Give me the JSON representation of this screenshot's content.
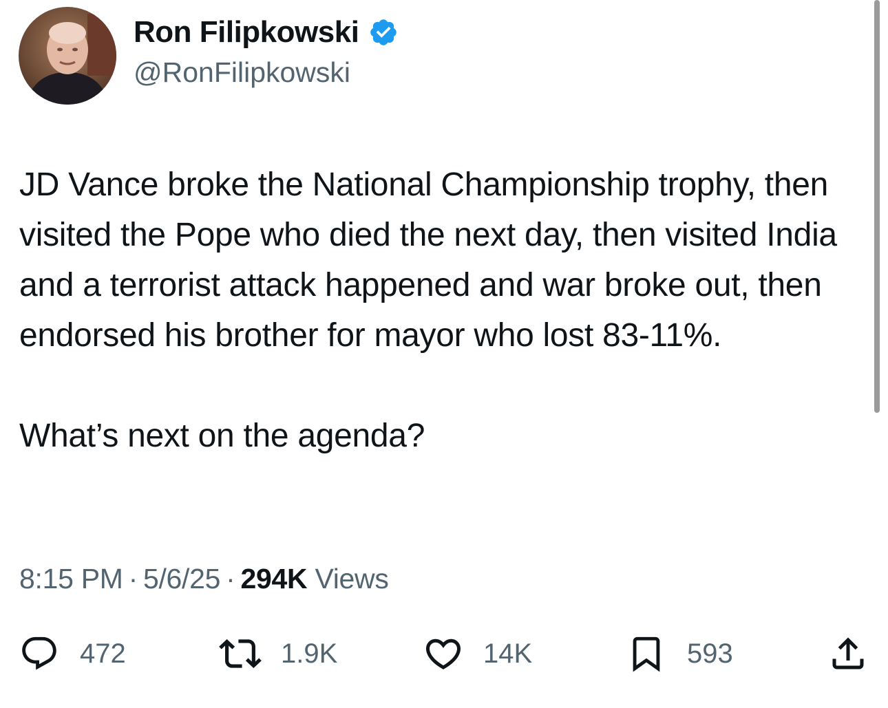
{
  "author": {
    "display_name": "Ron Filipkowski",
    "handle": "@RonFilipkowski",
    "verified": true,
    "verified_color": "#1d9bf0"
  },
  "tweet": {
    "paragraph_1": "JD Vance broke the National Championship trophy, then visited the Pope who died the next day, then visited India and a terrorist attack happened and war broke out, then endorsed his brother for mayor who lost 83-11%.",
    "paragraph_2": "What’s next on the agenda?"
  },
  "meta": {
    "time": "8:15 PM",
    "separator": "·",
    "date": "5/6/25",
    "views_count": "294K",
    "views_label": "Views"
  },
  "actions": {
    "replies": {
      "icon": "reply-icon",
      "count": "472"
    },
    "reposts": {
      "icon": "repost-icon",
      "count": "1.9K"
    },
    "likes": {
      "icon": "heart-icon",
      "count": "14K"
    },
    "bookmarks": {
      "icon": "bookmark-icon",
      "count": "593"
    },
    "share": {
      "icon": "share-icon"
    }
  },
  "colors": {
    "text_primary": "#0f1419",
    "text_secondary": "#536471"
  }
}
